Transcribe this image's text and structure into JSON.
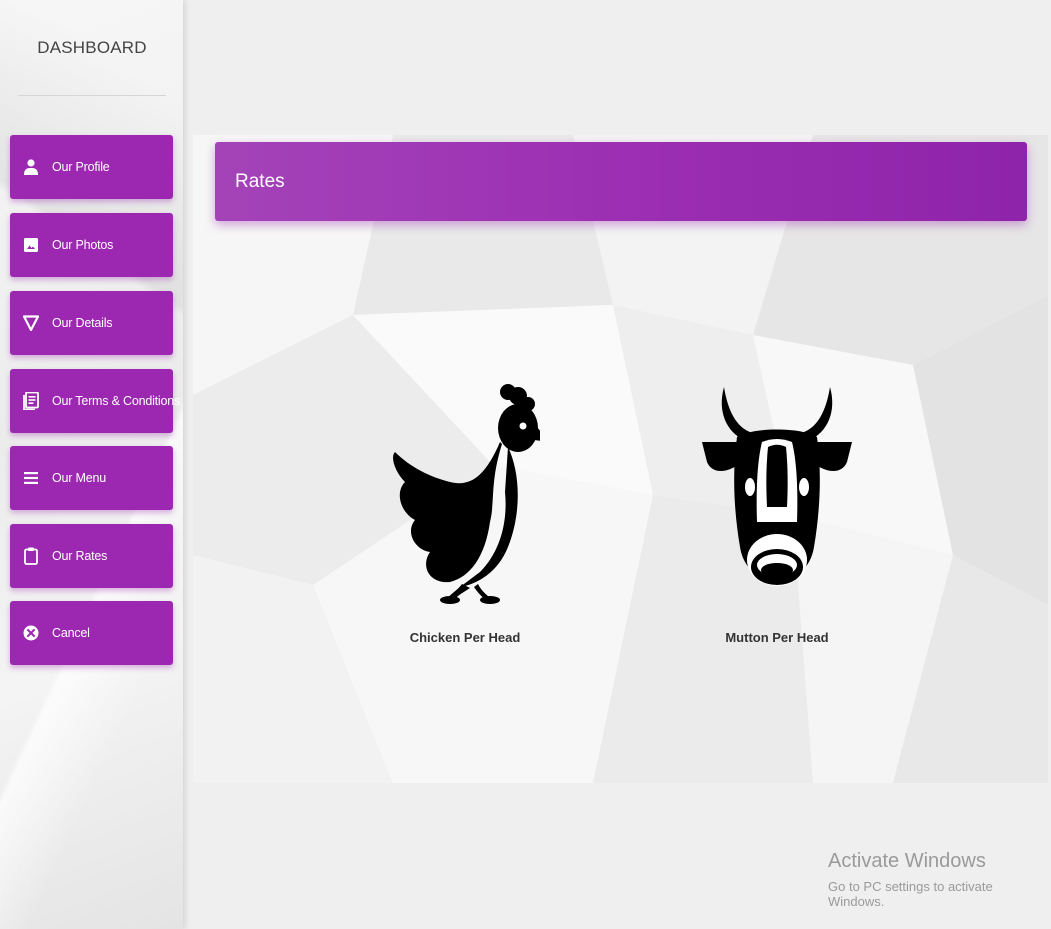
{
  "sidebar": {
    "title": "DASHBOARD",
    "items": [
      {
        "label": "Our Profile",
        "icon": "person-icon"
      },
      {
        "label": "Our Photos",
        "icon": "image-icon"
      },
      {
        "label": "Our Details",
        "icon": "triangle-down-icon"
      },
      {
        "label": "Our Terms & Conditions",
        "icon": "document-icon"
      },
      {
        "label": "Our Menu",
        "icon": "menu-icon"
      },
      {
        "label": "Our Rates",
        "icon": "clipboard-icon"
      },
      {
        "label": "Cancel",
        "icon": "cancel-icon"
      }
    ]
  },
  "main": {
    "header": "Rates",
    "cards": [
      {
        "label": "Chicken Per Head",
        "icon": "chicken-icon"
      },
      {
        "label": "Mutton Per Head",
        "icon": "cow-head-icon"
      }
    ]
  },
  "watermark": {
    "title": "Activate Windows",
    "subtitle": "Go to PC settings to activate Windows."
  },
  "colors": {
    "accent": "#9c27b0",
    "background": "#efefef",
    "icon": "#000000"
  }
}
